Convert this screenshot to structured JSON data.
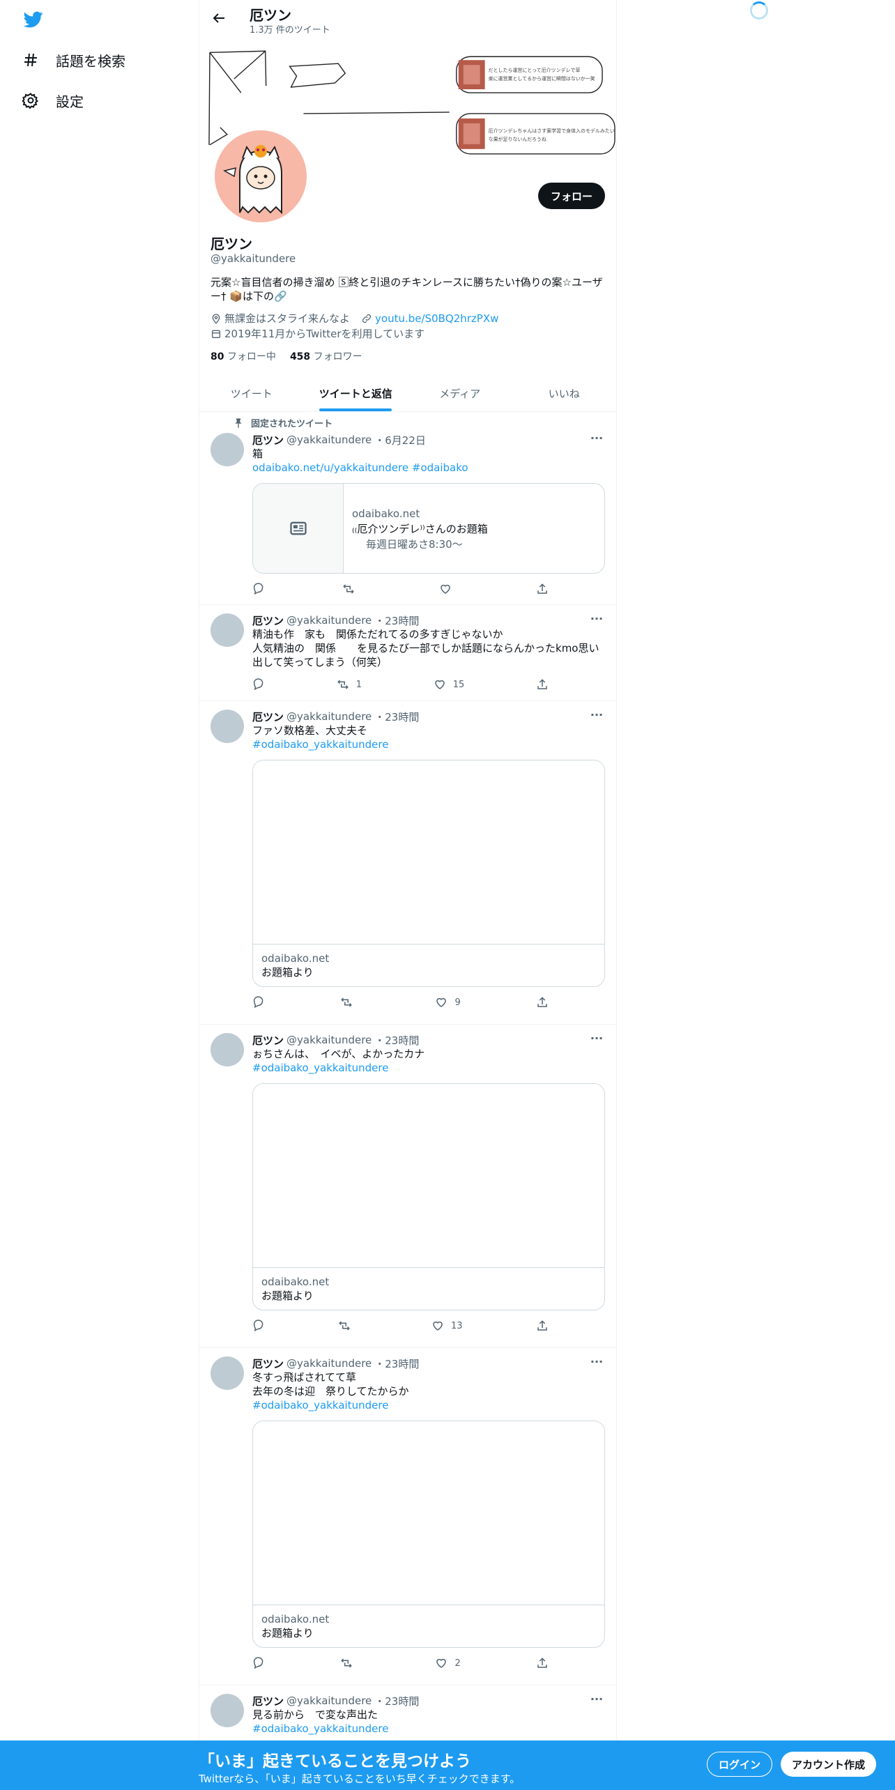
{
  "nav": {
    "explore_label": "話題を検索",
    "settings_label": "設定"
  },
  "header": {
    "title": "厄ツン",
    "tweet_count": "1.3万 件のツイート"
  },
  "profile": {
    "follow_label": "フォロー",
    "name": "厄ツン",
    "handle": "@yakkaitundere",
    "bio": "元案☆盲目信者の掃き溜め 🅂終と引退のチキンレースに勝ちたい†偽りの案☆ユーザー† 📦は下の🔗",
    "location": "無課金はスタライ来んなよ",
    "link": "youtu.be/S0BQ2hrzPXw",
    "joined": "2019年11月からTwitterを利用しています",
    "following_count": "80",
    "following_label": "フォロー中",
    "followers_count": "458",
    "followers_label": "フォロワー",
    "banner_text_1": "だとしたら運営にとって厄介ツンデレで草 楽に運営業としてるから運営に瞬間はないか一笑",
    "banner_text_2": "厄介ツンデレちゃんはさす案学習で身体入のモデルみたいな果が足りないんだろうね"
  },
  "tabs": [
    {
      "label": "ツイート"
    },
    {
      "label": "ツイートと返信"
    },
    {
      "label": "メディア"
    },
    {
      "label": "いいね"
    }
  ],
  "pinned_label": "固定されたツイート",
  "tweets": [
    {
      "name": "厄ツン",
      "handle": "@yakkaitundere",
      "time": "・6月22日",
      "text": "箱",
      "link": "odaibako.net/u/yakkaitundere",
      "hashtag": "#odaibako",
      "card_domain": "odaibako.net",
      "card_title": "₍₍厄介ツンデレ⁾⁾さんのお題箱",
      "card_desc": "毎週日曜あさ8:30〜",
      "retweets": "",
      "likes": ""
    },
    {
      "name": "厄ツン",
      "handle": "@yakkaitundere",
      "time": "・23時間",
      "text": "精油も作　家も　関係ただれてるの多すぎじゃないか\n人気精油の　関係　　を見るたび一部でしか話題にならんかったkmo思い出して笑ってしまう（何笑）",
      "retweets": "1",
      "likes": "15"
    },
    {
      "name": "厄ツン",
      "handle": "@yakkaitundere",
      "time": "・23時間",
      "text": "ファソ数格差、大丈夫そ",
      "hashtag": "#odaibako_yakkaitundere",
      "card_domain": "odaibako.net",
      "card_title": "お題箱より",
      "retweets": "",
      "likes": "9"
    },
    {
      "name": "厄ツン",
      "handle": "@yakkaitundere",
      "time": "・23時間",
      "text": "ぉちさんは、　イベが、よかったカナ",
      "hashtag": "#odaibako_yakkaitundere",
      "card_domain": "odaibako.net",
      "card_title": "お題箱より",
      "retweets": "",
      "likes": "13"
    },
    {
      "name": "厄ツン",
      "handle": "@yakkaitundere",
      "time": "・23時間",
      "text": "冬すっ飛ばされてて草\n去年の冬は迎　祭りしてたからか",
      "hashtag": "#odaibako_yakkaitundere",
      "card_domain": "odaibako.net",
      "card_title": "お題箱より",
      "retweets": "",
      "likes": "2"
    },
    {
      "name": "厄ツン",
      "handle": "@yakkaitundere",
      "time": "・23時間",
      "text": "見る前から　で変な声出た",
      "hashtag": "#odaibako_yakkaitundere"
    }
  ],
  "bottom_bar": {
    "title": "「いま」起きていることを見つけよう",
    "subtitle": "Twitterなら、「いま」起きていることをいち早くチェックできます。",
    "login_label": "ログイン",
    "signup_label": "アカウント作成"
  },
  "colors": {
    "accent": "#1d9bf0",
    "text": "#0f1419",
    "muted": "#536471",
    "border": "#eff3f4",
    "avatar_bg": "#f7b8a8"
  }
}
